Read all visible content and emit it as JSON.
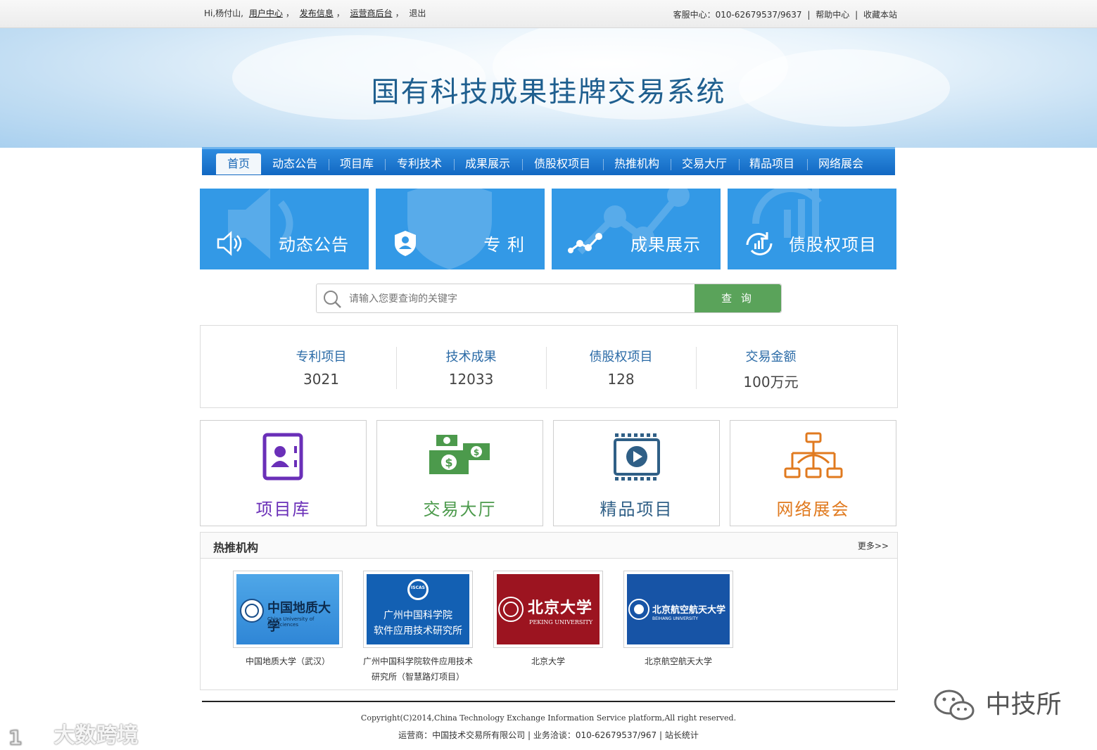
{
  "topbar": {
    "greeting": "Hi,杨付山,",
    "user_center": "用户中心",
    "comma1": "，",
    "publish": "发布信息",
    "comma2": "，",
    "operator_admin": "运营商后台",
    "comma3": "，",
    "logout": "退出",
    "service": "客服中心：010-62679537/9637",
    "help": "帮助中心",
    "favorite": "收藏本站",
    "sep": "|"
  },
  "banner": {
    "title": "国有科技成果挂牌交易系统"
  },
  "nav": {
    "items": [
      "首页",
      "动态公告",
      "项目库",
      "专利技术",
      "成果展示",
      "债股权项目",
      "热推机构",
      "交易大厅",
      "精品项目",
      "网络展会"
    ]
  },
  "tiles": [
    {
      "label": "动态公告",
      "icon": "speaker-icon"
    },
    {
      "label": "专 利",
      "icon": "shield-user-icon"
    },
    {
      "label": "成果展示",
      "icon": "network-graph-icon"
    },
    {
      "label": "债股权项目",
      "icon": "refresh-chart-icon"
    }
  ],
  "search": {
    "placeholder": "请输入您要查询的关键字",
    "button": "查 询"
  },
  "stats": [
    {
      "title": "专利项目",
      "value": "3021"
    },
    {
      "title": "技术成果",
      "value": "12033"
    },
    {
      "title": "债股权项目",
      "value": "128"
    },
    {
      "title": "交易金额",
      "value": "100万元"
    }
  ],
  "cards": [
    {
      "label": "项目库",
      "color": "#6a2fb8",
      "icon": "contact-book-icon"
    },
    {
      "label": "交易大厅",
      "color": "#4c9a4c",
      "icon": "money-icon"
    },
    {
      "label": "精品项目",
      "color": "#2f5f86",
      "icon": "video-play-icon"
    },
    {
      "label": "网络展会",
      "color": "#e07a1f",
      "icon": "org-chart-icon"
    }
  ],
  "hot": {
    "title": "热推机构",
    "more": "更多>>",
    "orgs": [
      {
        "caption": "中国地质大学（武汉）",
        "logo_text": "中国地质大学",
        "logo_sub": "China University of Geosciences"
      },
      {
        "caption": "广州中国科学院软件应用技术研究所（智慧路灯项目）",
        "logo_text": "广州中国科学院",
        "logo_text2": "软件应用技术研究所",
        "logo_badge": "ISCAS"
      },
      {
        "caption": "北京大学",
        "logo_text": "北京大学",
        "logo_sub": "PEKING UNIVERSITY"
      },
      {
        "caption": "北京航空航天大学",
        "logo_text": "北京航空航天大学",
        "logo_sub": "BEIHANG UNIVERSITY"
      }
    ]
  },
  "footer": {
    "copyright": "Copyright(C)2014,China Technology Exchange Information Service platform,All right reserved.",
    "operator": "运营商：中国技术交易所有限公司",
    "business": "业务洽谈：010-62679537/967",
    "stats": "站长统计",
    "sep": "|"
  },
  "watermarks": {
    "left": "大数跨境",
    "right": "中技所"
  },
  "colors": {
    "nav": "#1a78d4",
    "tile": "#3399e6",
    "search_button": "#5aa35a"
  }
}
